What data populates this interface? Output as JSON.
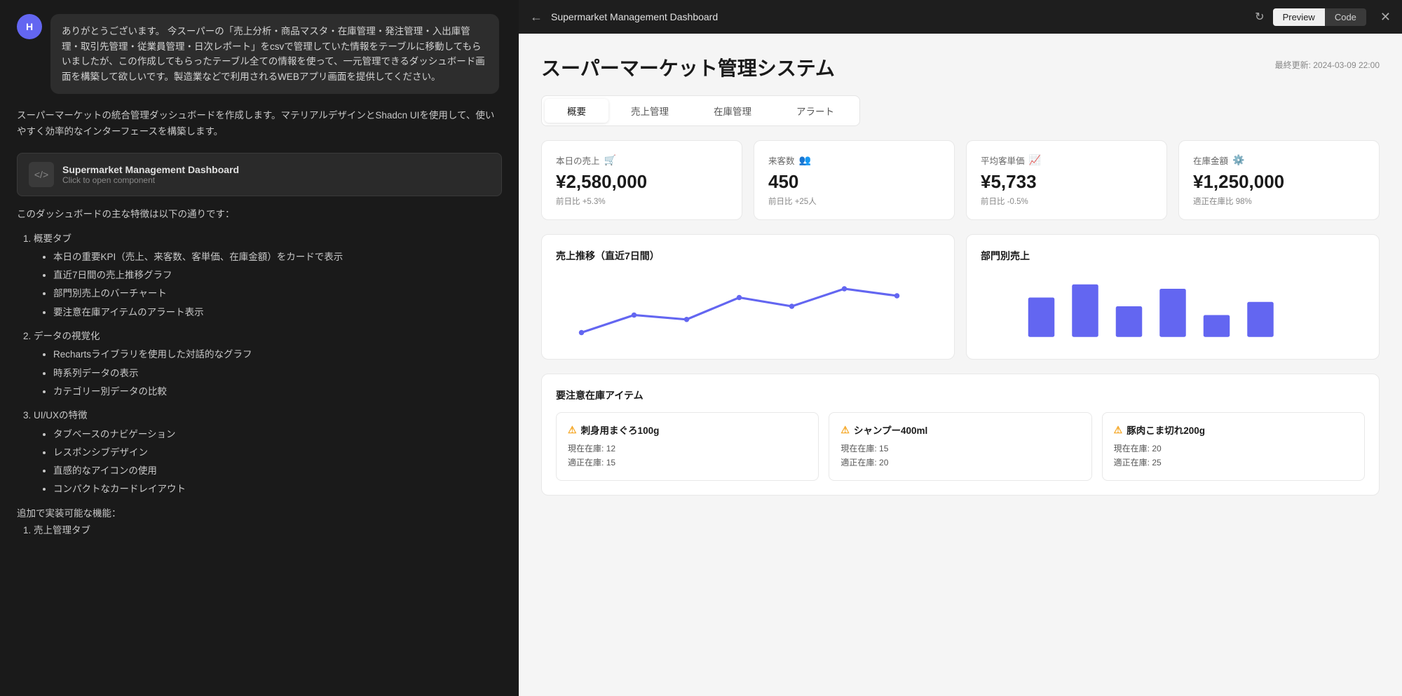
{
  "left": {
    "avatar_letter": "H",
    "user_message": "ありがとうございます。\n今スーパーの「売上分析・商品マスタ・在庫管理・発注管理・入出庫管理・取引先管理・従業員管理・日次レポート」をcsvで管理していた情報をテーブルに移動してもらいましたが、この作成してもらったテーブル全ての情報を使って、一元管理できるダッシュボード画面を構築して欲しいです。製造業などで利用されるWEBアプリ画面を提供してください。",
    "assistant_intro": "スーパーマーケットの統合管理ダッシュボードを作成します。マテリアルデザインとShadcn UIを使用して、使いやすく効率的なインターフェースを構築します。",
    "component_title": "Supermarket Management Dashboard",
    "component_subtitle": "Click to open component",
    "features_text": "このダッシュボードの主な特徴は以下の通りです：",
    "feature_sections": [
      {
        "title": "1. 概要タブ",
        "items": [
          "本日の重要KPI（売上、来客数、客単価、在庫金額）をカードで表示",
          "直近7日間の売上推移グラフ",
          "部門別売上のバーチャート",
          "要注意在庫アイテムのアラート表示"
        ]
      },
      {
        "title": "2. データの視覚化",
        "items": [
          "Rechartsライブラリを使用した対話的なグラフ",
          "時系列データの表示",
          "カテゴリー別データの比較"
        ]
      },
      {
        "title": "3. UI/UXの特徴",
        "items": [
          "タブベースのナビゲーション",
          "レスポンシブデザイン",
          "直感的なアイコンの使用",
          "コンパクトなカードレイアウト"
        ]
      }
    ],
    "additional_text": "追加で実装可能な機能：",
    "additional_sections": [
      {
        "title": "1. 売上管理タブ"
      }
    ]
  },
  "topbar": {
    "back_label": "←",
    "title": "Supermarket Management Dashboard",
    "refresh_label": "↻",
    "preview_label": "Preview",
    "code_label": "Code",
    "close_label": "✕"
  },
  "dashboard": {
    "title": "スーパーマーケット管理システム",
    "updated": "最終更新: 2024-03-09 22:00",
    "tabs": [
      {
        "label": "概要",
        "active": true
      },
      {
        "label": "売上管理",
        "active": false
      },
      {
        "label": "在庫管理",
        "active": false
      },
      {
        "label": "アラート",
        "active": false
      }
    ],
    "kpi_cards": [
      {
        "label": "本日の売上",
        "icon": "🛒",
        "value": "¥2,580,000",
        "change": "前日比 +5.3%"
      },
      {
        "label": "来客数",
        "icon": "👥",
        "value": "450",
        "change": "前日比 +25人"
      },
      {
        "label": "平均客単価",
        "icon": "📈",
        "value": "¥5,733",
        "change": "前日比 -0.5%"
      },
      {
        "label": "在庫金額",
        "icon": "⚙️",
        "value": "¥1,250,000",
        "change": "適正在庫比 98%"
      }
    ],
    "chart_sales_title": "売上推移（直近7日間）",
    "chart_dept_title": "部門別売上",
    "alert_title": "要注意在庫アイテム",
    "alert_items": [
      {
        "name": "刺身用まぐろ100g",
        "current": "12",
        "optimal": "15"
      },
      {
        "name": "シャンプー400ml",
        "current": "15",
        "optimal": "20"
      },
      {
        "name": "豚肉こま切れ200g",
        "current": "20",
        "optimal": "25"
      }
    ],
    "current_label": "現在在庫:",
    "optimal_label": "適正在庫:"
  }
}
